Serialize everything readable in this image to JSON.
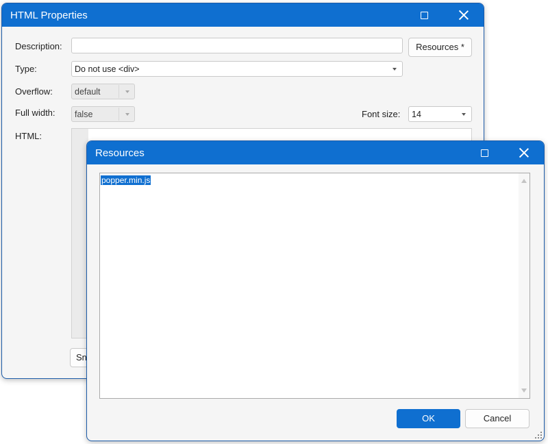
{
  "html_properties": {
    "title": "HTML Properties",
    "description": {
      "label": "Description:",
      "value": ""
    },
    "resources_button": "Resources *",
    "type": {
      "label": "Type:",
      "value": "Do not use <div>"
    },
    "overflow": {
      "label": "Overflow:",
      "value": "default"
    },
    "full_width": {
      "label": "Full width:",
      "value": "false"
    },
    "font_size": {
      "label": "Font size:",
      "value": "14"
    },
    "html": {
      "label": "HTML:"
    },
    "partial_button": "Sn"
  },
  "resources_dialog": {
    "title": "Resources",
    "items": [
      "popper.min.js"
    ],
    "ok_label": "OK",
    "cancel_label": "Cancel"
  },
  "colors": {
    "titlebar": "#0f6fd0",
    "selection": "#0f6fd0",
    "window_bg": "#f5f5f5"
  }
}
